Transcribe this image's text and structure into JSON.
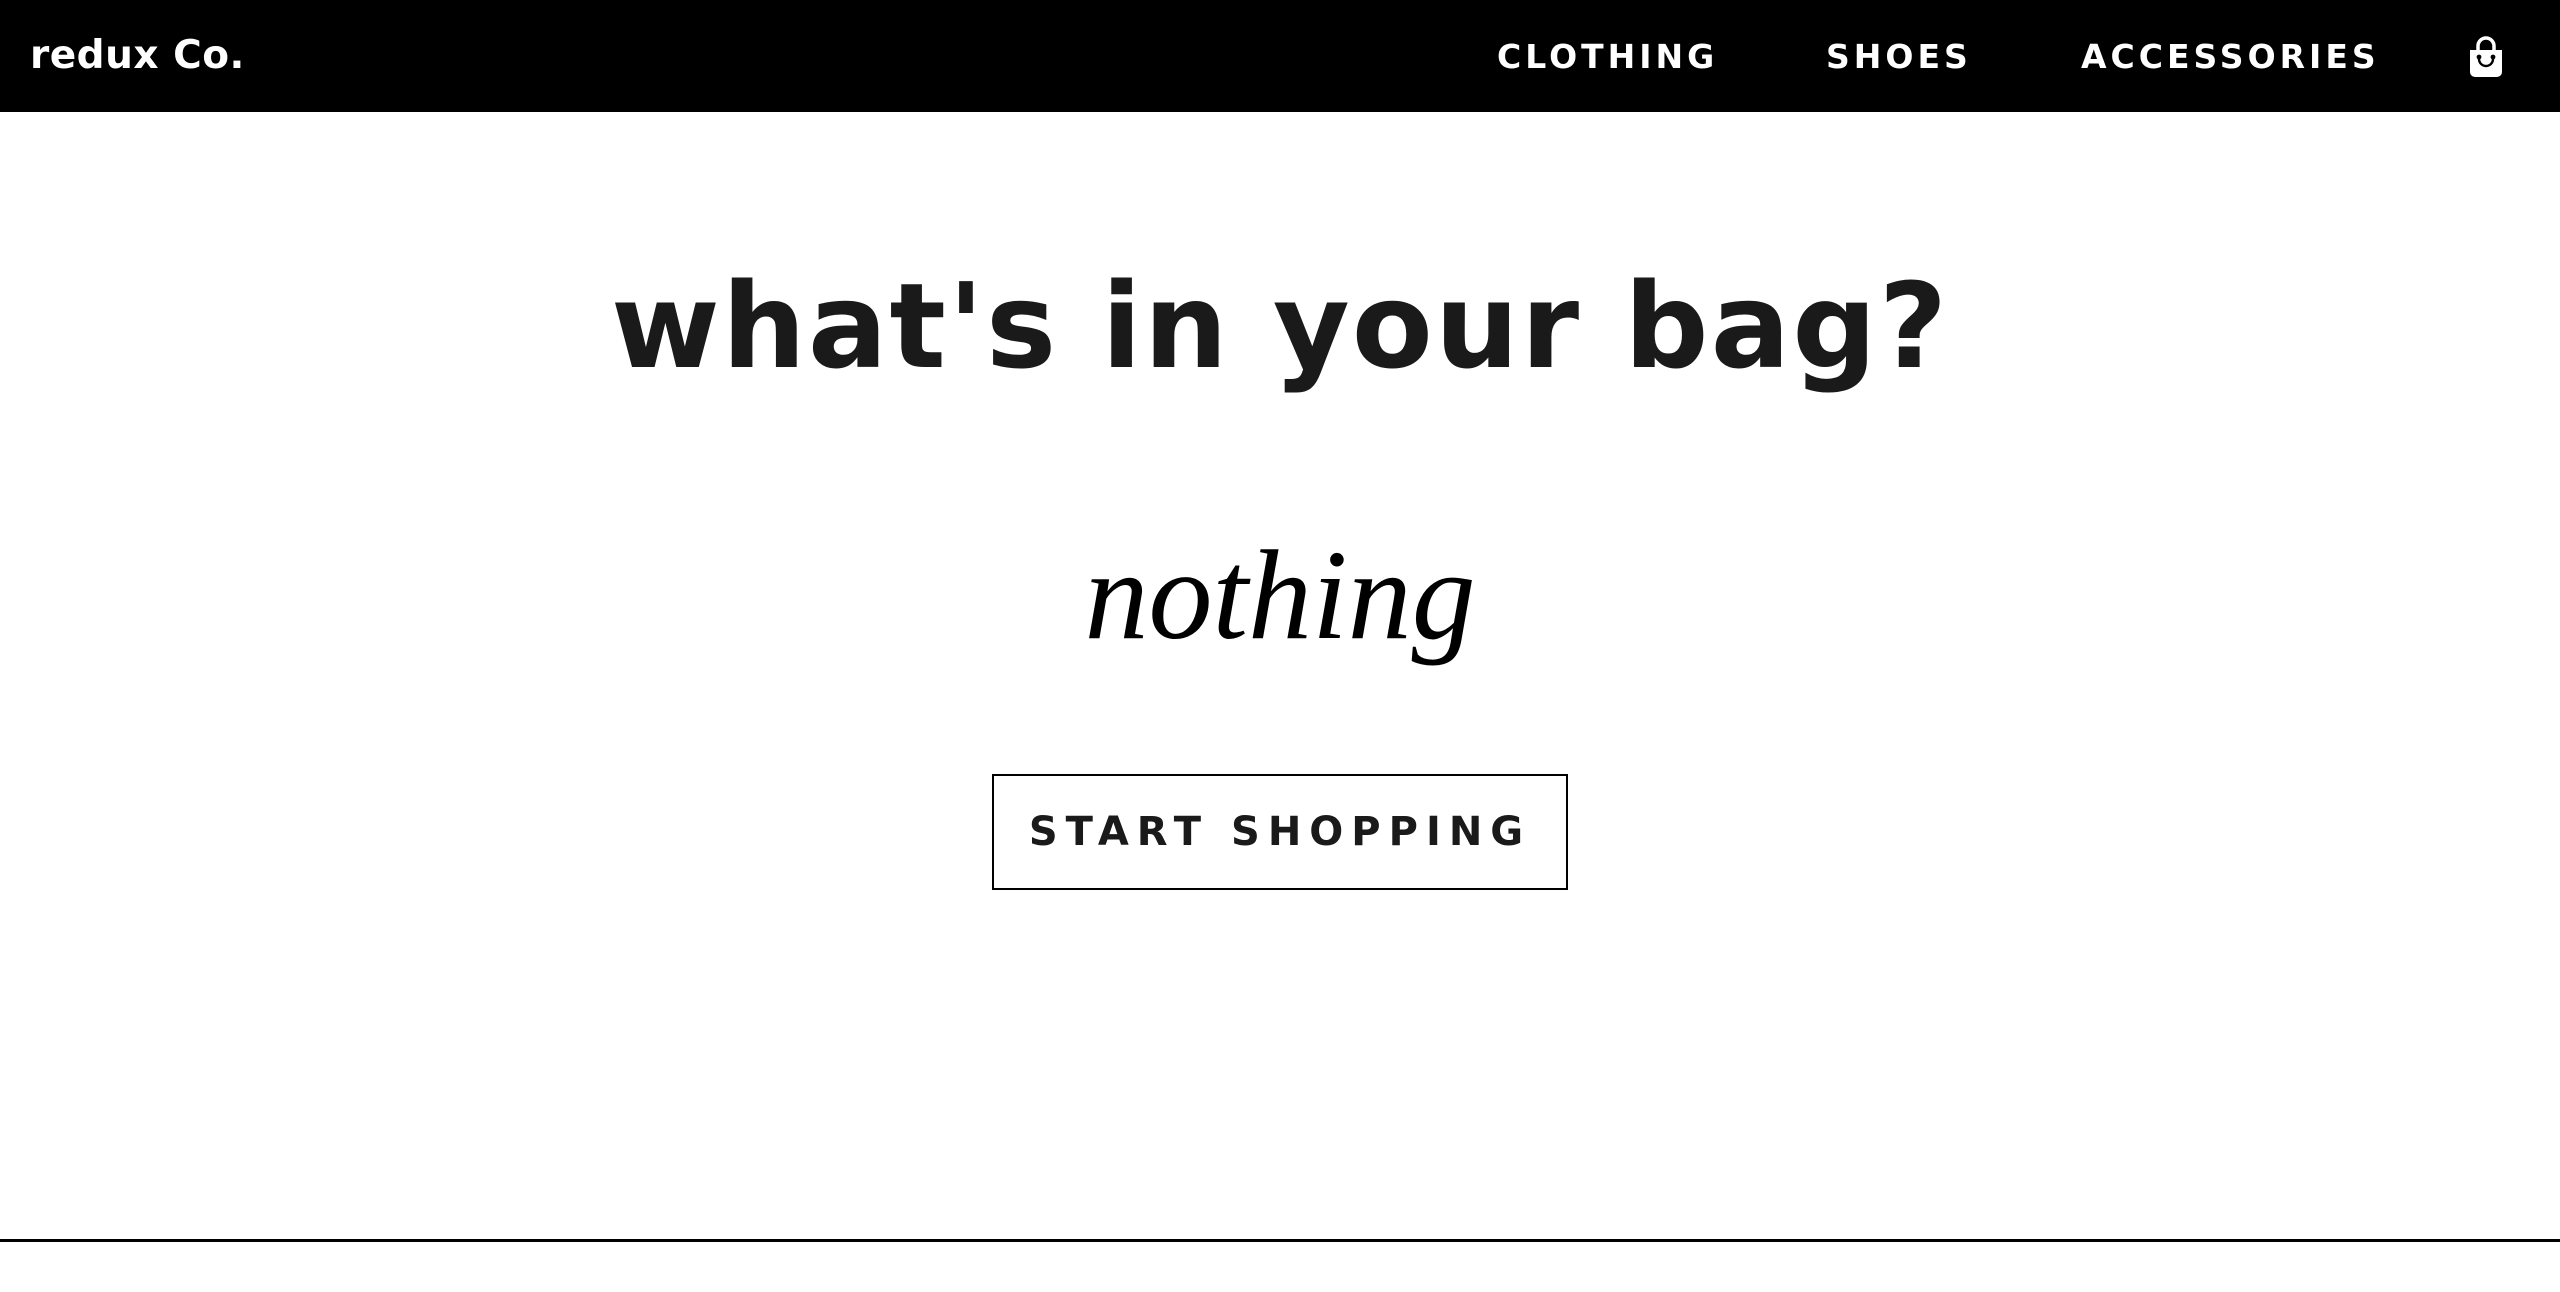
{
  "header": {
    "brand": "redux Co.",
    "nav": {
      "clothing": "CLOTHING",
      "shoes": "SHOES",
      "accessories": "ACCESSORIES"
    },
    "bag_icon": "shopping-bag-icon"
  },
  "main": {
    "title": "what's in your bag?",
    "empty_message": "nothing",
    "cta_label": "START SHOPPING"
  },
  "colors": {
    "nav_background": "#000000",
    "nav_text": "#ffffff",
    "page_background": "#ffffff",
    "text": "#1a1a1a",
    "button_border": "#000000"
  }
}
